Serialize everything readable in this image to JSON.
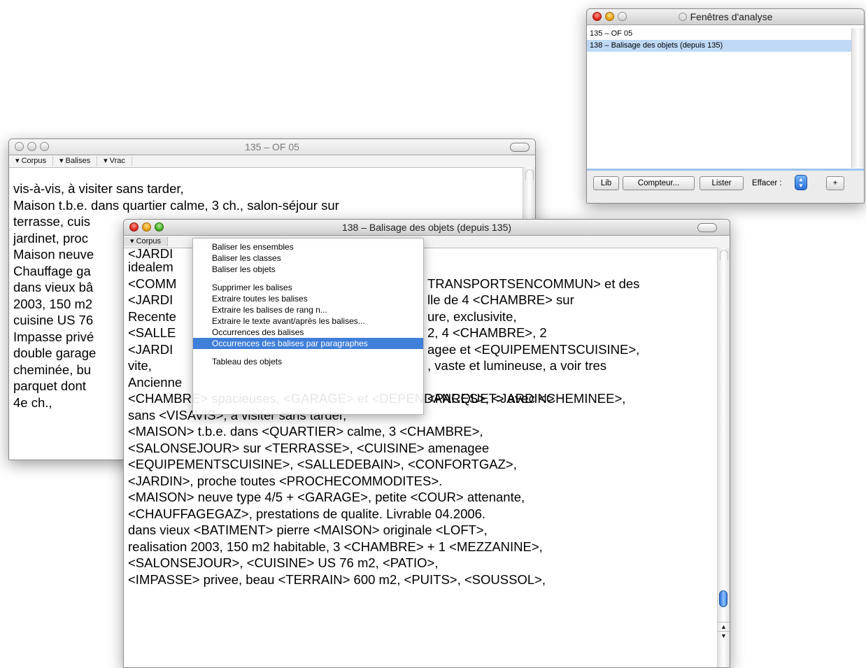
{
  "window_135": {
    "title": "135 – OF 05",
    "toolbar": [
      "▾ Corpus",
      "▾ Balises",
      "▾ Vrac"
    ],
    "lines": [
      "vis-à-vis, à visiter sans tarder,",
      "Maison t.b.e. dans quartier calme, 3 ch., salon-séjour sur",
      "terrasse, cuis",
      "jardinet, proc",
      "Maison neuve",
      "Chauffage ga",
      "dans vieux bâ",
      "2003, 150 m2",
      "cuisine US 76",
      "Impasse privé",
      "double garage",
      "cheminée, bu",
      "parquet dont",
      "4e ch.,"
    ]
  },
  "window_138": {
    "title": "138 – Balisage des objets (depuis 135)",
    "toolbar": [
      "▾ Corpus"
    ],
    "lines": [
      "<JARDI",
      "idealem",
      "<COMM",
      "<JARDI",
      "Recente",
      "<SALLE",
      "<JARDI",
      "vite,",
      "Ancienne",
      "<CHAMBRE> spacieuses, <GARAGE> et <DEPENDANCES>, <JARDIN>",
      "sans <VISAVIS>, a visiter sans tarder,",
      "<MAISON> t.b.e. dans <QUARTIER> calme, 3 <CHAMBRE>,",
      "<SALONSEJOUR> sur <TERRASSE>, <CUISINE> amenagee",
      "<EQUIPEMENTSCUISINE>, <SALLEDEBAIN>, <CONFORTGAZ>,",
      "<JARDIN>, proche toutes <PROCHECOMMODITES>.",
      "<MAISON> neuve type 4/5 + <GARAGE>, petite <COUR> attenante,",
      "<CHAUFFAGEGAZ>, prestations de qualite. Livrable 04.2006.",
      "dans vieux <BATIMENT> pierre <MAISON> originale <LOFT>,",
      "realisation 2003, 150 m2 habitable, 3 <CHAMBRE> + 1 <MEZZANINE>,",
      "<SALONSEJOUR>, <CUISINE> US 76 m2, <PATIO>,",
      "<IMPASSE> privee, beau <TERRAIN> 600 m2, <PUITS>, <SOUSSOL>,"
    ],
    "right_fragments": [
      "",
      "TRANSPORTSENCOMMUN> et des",
      "lle de 4 <CHAMBRE> sur",
      "ure, exclusivite,",
      "2, 4 <CHAMBRE>, 2",
      "agee et <EQUIPEMENTSCUISINE>,",
      ", vaste et lumineuse, a voir tres",
      "",
      " <PARQUET> avec <CHEMINEE>,"
    ]
  },
  "corpus_menu": {
    "items": [
      "Baliser les ensembles",
      "Baliser les classes",
      "Baliser les objets",
      "",
      "Supprimer les balises",
      "Extraire toutes les balises",
      "Extraire les balises de rang n...",
      "Extraire le texte avant/après les balises...",
      "Occurrences des balises",
      "Occurrences des balises par paragraphes",
      "",
      "Tableau des objets"
    ],
    "selected_index": 9
  },
  "analysis_window": {
    "title": "Fenêtres d'analyse",
    "items": [
      "135 – OF 05",
      "138 – Balisage des objets (depuis 135)"
    ],
    "selected_index": 1,
    "buttons": {
      "lib": "Lib",
      "compteur": "Compteur...",
      "lister": "Lister",
      "effacer_label": "Effacer :",
      "plus": "+"
    }
  },
  "colors": {
    "menu_highlight": "#3f7fda",
    "list_selection": "#bfd9f7",
    "scroll_thumb": "#3d7ee0"
  }
}
